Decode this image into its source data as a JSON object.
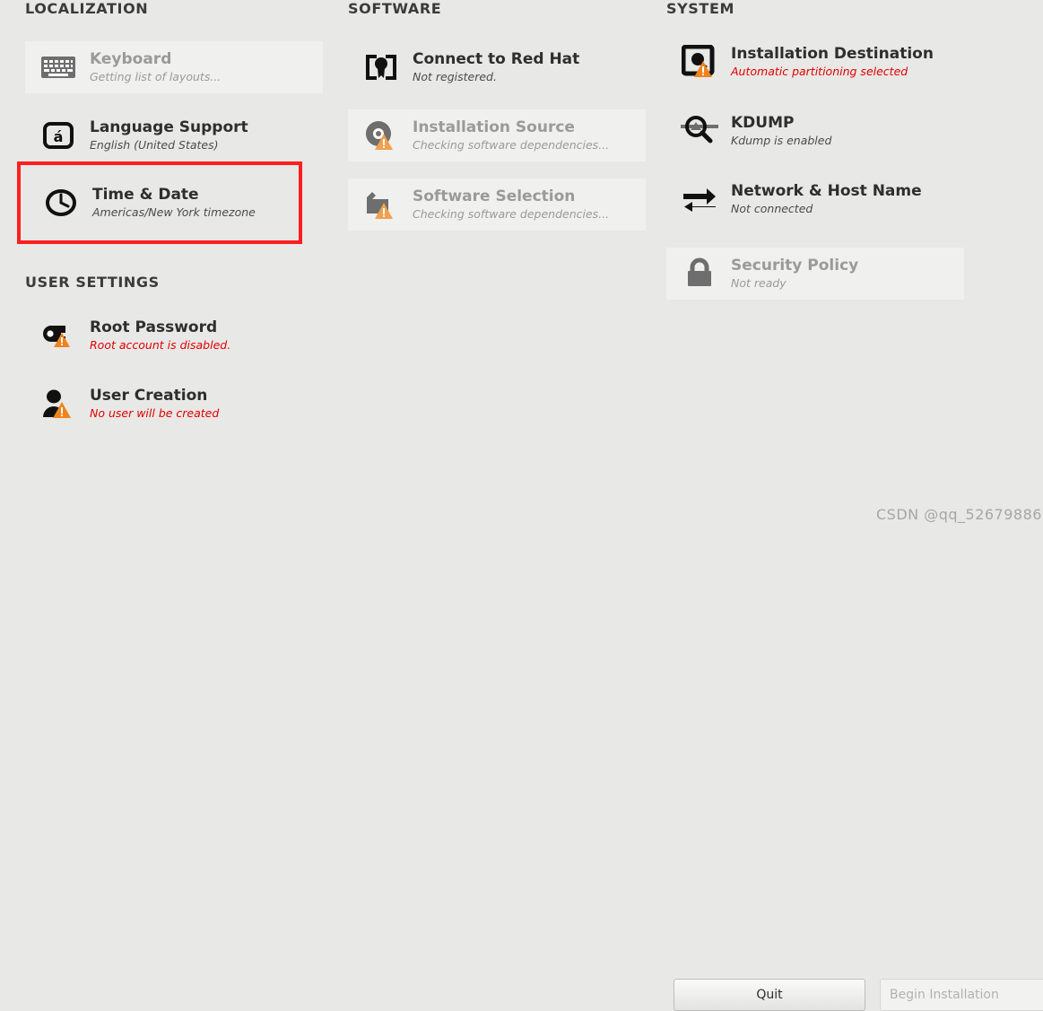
{
  "app": {
    "background_color": "#e8e8e6",
    "accent_warning_color": "#e00000",
    "highlight_box_color": "#fb1f1f",
    "warning_triangle_color": "#f0831e"
  },
  "columns": {
    "localization": {
      "title": "LOCALIZATION",
      "items": [
        {
          "icon": "keyboard-icon",
          "title": "Keyboard",
          "subtitle": "Getting list of layouts...",
          "state": "disabled",
          "warning": false,
          "highlighted": false
        },
        {
          "icon": "language-support-icon",
          "title": "Language Support",
          "subtitle": "English (United States)",
          "state": "enabled",
          "warning": false,
          "highlighted": false
        },
        {
          "icon": "time-and-date-icon",
          "title": "Time & Date",
          "subtitle": "Americas/New York timezone",
          "state": "enabled",
          "warning": false,
          "highlighted": true
        }
      ]
    },
    "user_settings": {
      "title": "USER SETTINGS",
      "items": [
        {
          "icon": "root-password-icon",
          "title": "Root Password",
          "subtitle": "Root account is disabled.",
          "state": "enabled",
          "warning": true,
          "highlighted": false
        },
        {
          "icon": "user-creation-icon",
          "title": "User Creation",
          "subtitle": "No user will be created",
          "state": "enabled",
          "warning": true,
          "highlighted": false
        }
      ]
    },
    "software": {
      "title": "SOFTWARE",
      "items": [
        {
          "icon": "connect-to-red-hat-icon",
          "title": "Connect to Red Hat",
          "subtitle": "Not registered.",
          "state": "enabled",
          "warning": false,
          "highlighted": false
        },
        {
          "icon": "installation-source-icon",
          "title": "Installation Source",
          "subtitle": "Checking software dependencies...",
          "state": "disabled",
          "warning": true,
          "highlighted": false
        },
        {
          "icon": "software-selection-icon",
          "title": "Software Selection",
          "subtitle": "Checking software dependencies...",
          "state": "disabled",
          "warning": true,
          "highlighted": false
        }
      ]
    },
    "system": {
      "title": "SYSTEM",
      "items": [
        {
          "icon": "installation-destination-icon",
          "title": "Installation Destination",
          "subtitle": "Automatic partitioning selected",
          "state": "enabled",
          "warning": true,
          "highlighted": false
        },
        {
          "icon": "kdump-icon",
          "title": "KDUMP",
          "subtitle": "Kdump is enabled",
          "state": "enabled",
          "warning": false,
          "highlighted": false
        },
        {
          "icon": "network-and-host-name-icon",
          "title": "Network & Host Name",
          "subtitle": "Not connected",
          "state": "enabled",
          "warning": false,
          "highlighted": false
        },
        {
          "icon": "security-policy-icon",
          "title": "Security Policy",
          "subtitle": "Not ready",
          "state": "disabled",
          "warning": false,
          "highlighted": false
        }
      ]
    }
  },
  "footer": {
    "quit_label": "Quit",
    "begin_installation_label": "Begin Installation"
  },
  "watermark": {
    "text": "CSDN @qq_52679886"
  }
}
